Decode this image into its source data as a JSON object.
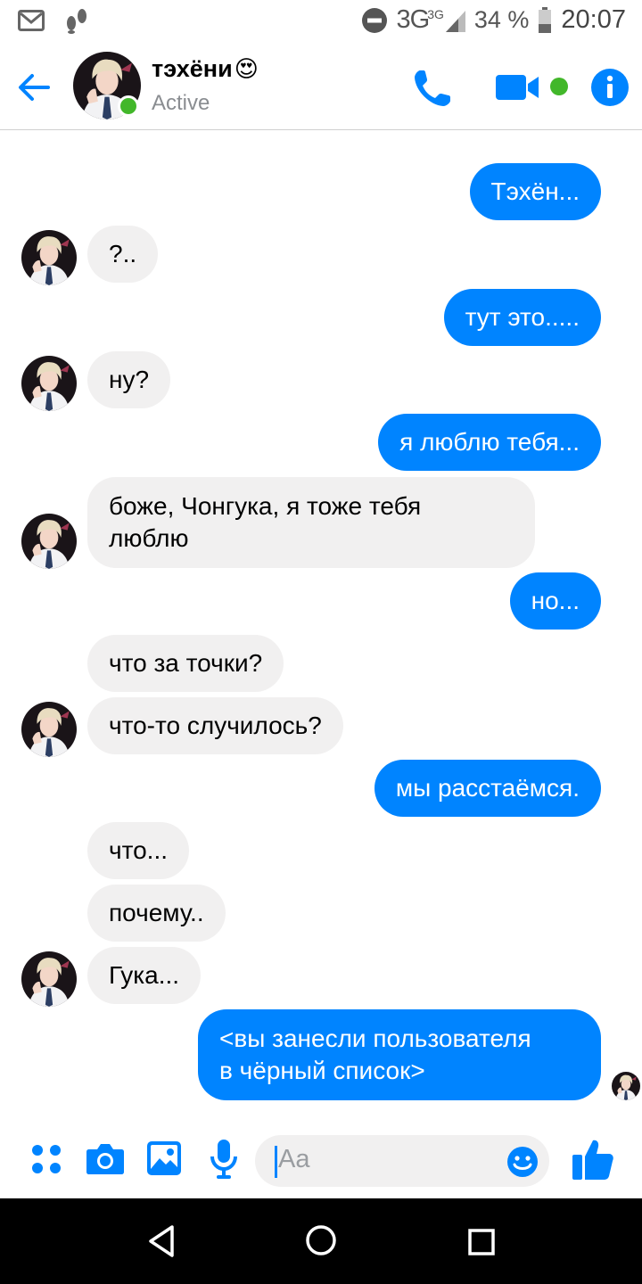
{
  "status_bar": {
    "network": "3G",
    "network_small": "3G",
    "battery": "34 %",
    "time": "20:07",
    "icons": [
      "mail-icon",
      "steps-icon",
      "do-not-disturb-icon",
      "signal-icon",
      "battery-icon"
    ]
  },
  "header": {
    "name": "тэхёни",
    "name_emoji": "😍",
    "status": "Active",
    "icons": [
      "back-arrow-icon",
      "phone-icon",
      "video-camera-icon",
      "info-icon"
    ]
  },
  "messages": [
    {
      "side": "out",
      "text": "Тэхён..."
    },
    {
      "side": "in",
      "text": "?.."
    },
    {
      "side": "out",
      "text": "тут это....."
    },
    {
      "side": "in",
      "text": "ну?"
    },
    {
      "side": "out",
      "text": "я люблю тебя..."
    },
    {
      "side": "in",
      "text": "боже, Чонгука, я тоже тебя\nлюблю"
    },
    {
      "side": "out",
      "text": "но..."
    },
    {
      "side": "in",
      "text": "что за точки?"
    },
    {
      "side": "in",
      "text": "что-то случилось?"
    },
    {
      "side": "out",
      "text": "мы расстаёмся."
    },
    {
      "side": "in",
      "text": "что..."
    },
    {
      "side": "in",
      "text": "почему.."
    },
    {
      "side": "in",
      "text": "Гука..."
    },
    {
      "side": "out",
      "text": "<вы занесли пользователя\nв чёрный список>"
    }
  ],
  "composer": {
    "placeholder": "Aa",
    "icons": [
      "more-apps-icon",
      "camera-icon",
      "gallery-icon",
      "microphone-icon",
      "emoji-icon",
      "like-icon"
    ]
  },
  "nav_bar": {
    "icons": [
      "back-triangle-icon",
      "home-circle-icon",
      "recents-square-icon"
    ]
  },
  "colors": {
    "accent": "#0084ff",
    "incoming_bubble": "#f1f0f0",
    "online": "#42b72a"
  }
}
